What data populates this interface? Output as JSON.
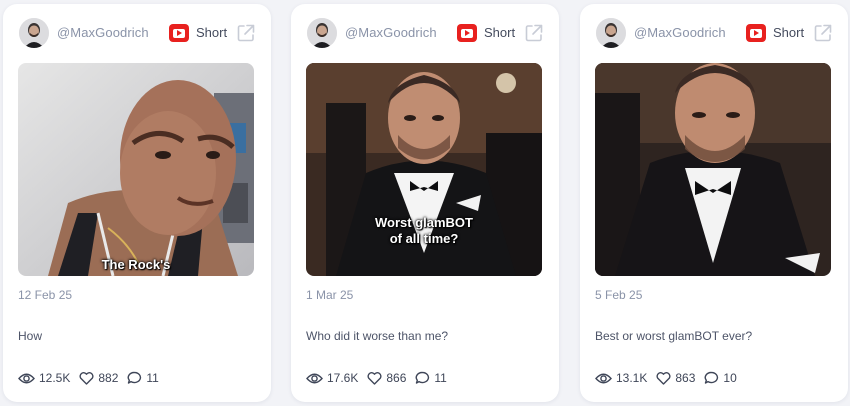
{
  "cards": [
    {
      "handle": "@MaxGoodrich",
      "type_label": "Short",
      "caption": "The Rock's",
      "date": "12 Feb 25",
      "title": "How",
      "views": "12.5K",
      "likes": "882",
      "comments": "11"
    },
    {
      "handle": "@MaxGoodrich",
      "type_label": "Short",
      "caption": "Worst glamBOT\nof all time?",
      "date": "1 Mar 25",
      "title": "Who did it worse than me?",
      "views": "17.6K",
      "likes": "866",
      "comments": "11"
    },
    {
      "handle": "@MaxGoodrich",
      "type_label": "Short",
      "caption": "",
      "date": "5 Feb 25",
      "title": "Best or worst glamBOT ever?",
      "views": "13.1K",
      "likes": "863",
      "comments": "10"
    }
  ],
  "icons": {
    "platform": "youtube-icon",
    "open": "external-link-icon",
    "views": "eye-icon",
    "likes": "heart-icon",
    "comments": "comment-icon"
  },
  "colors": {
    "youtube_red": "#e8211f",
    "muted_text": "#8a93a8",
    "body_text": "#4d5468"
  }
}
